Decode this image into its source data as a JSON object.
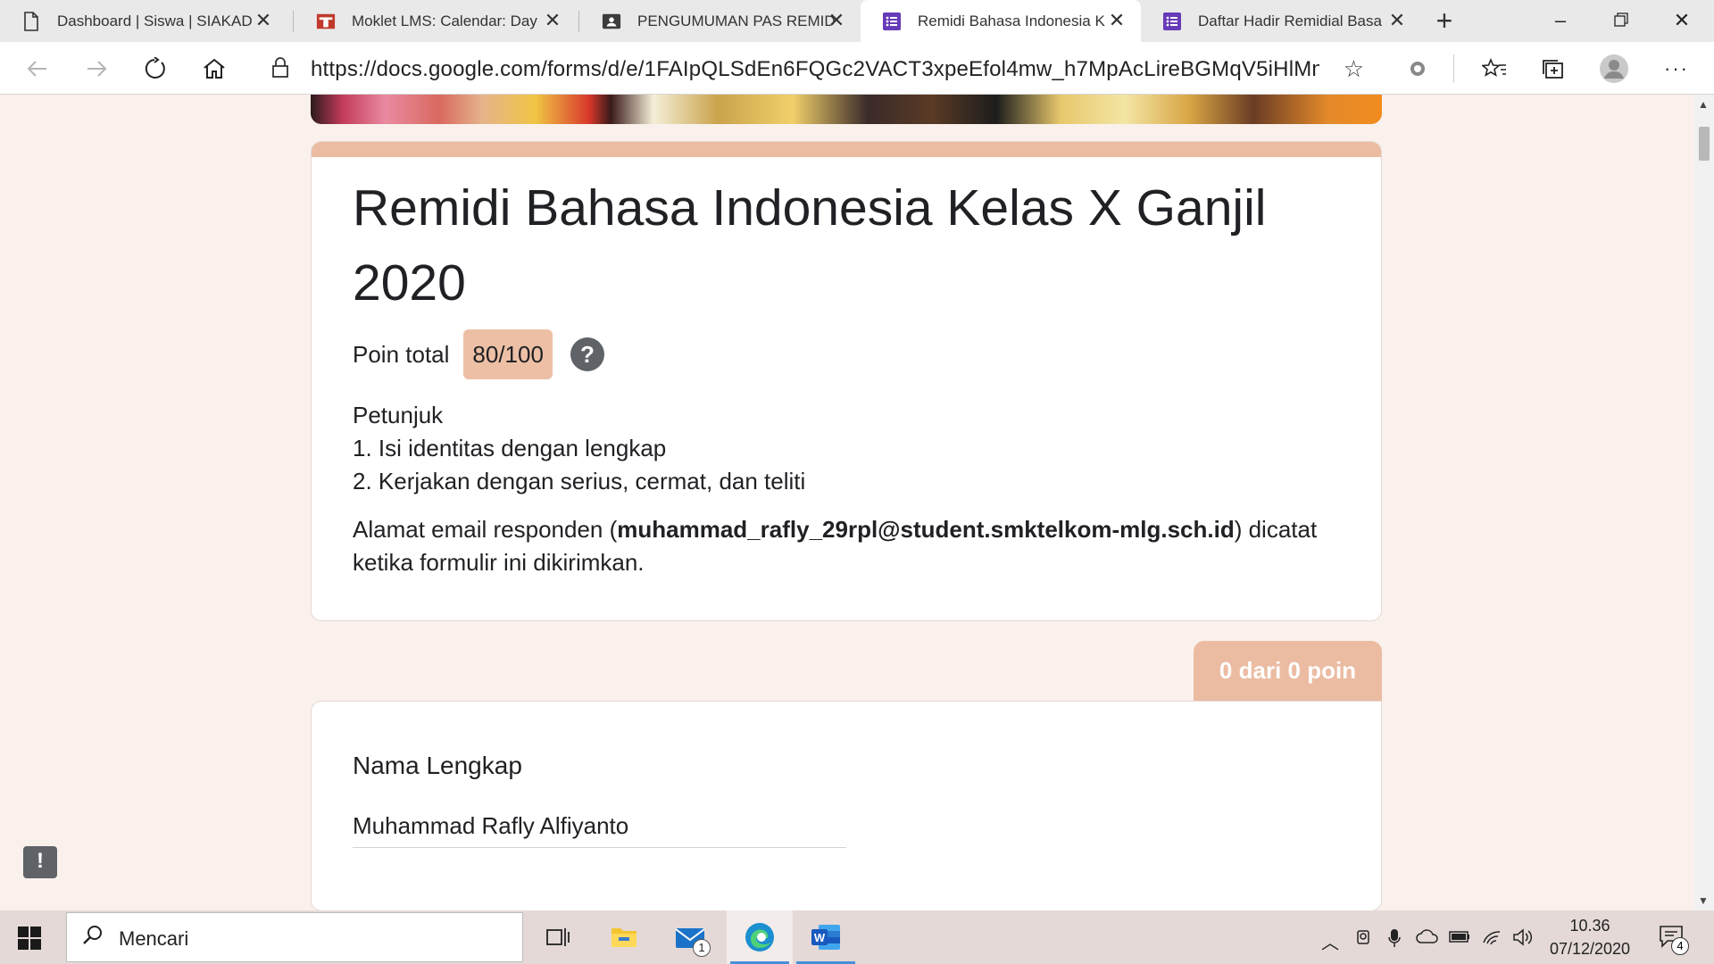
{
  "browser": {
    "tabs": [
      {
        "label": "Dashboard | Siswa | SIAKAD",
        "icon": "page-icon"
      },
      {
        "label": "Moklet LMS: Calendar: Day",
        "icon": "moklet-icon"
      },
      {
        "label": "PENGUMUMAN PAS REMID",
        "icon": "classroom-icon"
      },
      {
        "label": "Remidi Bahasa Indonesia K",
        "icon": "forms-icon"
      },
      {
        "label": "Daftar Hadir Remidial Basa",
        "icon": "forms-icon"
      }
    ],
    "url": "https://docs.google.com/forms/d/e/1FAIpQLSdEn6FQGc2VACT3xpeEfol4mw_h7MpAcLireBGMqV5iHlMm..."
  },
  "form": {
    "title": "Remidi Bahasa Indonesia Kelas X Ganjil 2020",
    "score_label": "Poin total",
    "score_value": "80/100",
    "instructions": {
      "heading": "Petunjuk",
      "items": [
        "1. Isi identitas dengan lengkap",
        "2. Kerjakan dengan serius, cermat, dan teliti"
      ]
    },
    "email_note": {
      "prefix": "Alamat email responden (",
      "email": "muhammad_rafly_29rpl@student.smktelkom-mlg.sch.id",
      "suffix": ") dicatat ketika formulir ini dikirimkan."
    },
    "points_badge": "0 dari 0 poin",
    "question": {
      "title": "Nama Lengkap",
      "answer": "Muhammad Rafly Alfiyanto"
    },
    "accent_color": "#ebbca2"
  },
  "taskbar": {
    "search_placeholder": "Mencari",
    "mail_badge": "1",
    "time": "10.36",
    "date": "07/12/2020",
    "notification_count": "4"
  }
}
